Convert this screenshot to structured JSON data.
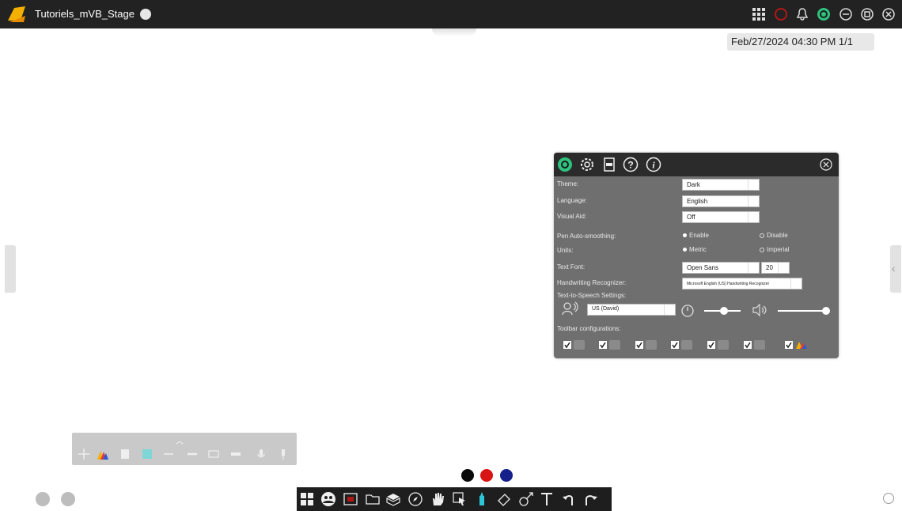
{
  "app": {
    "title": "Tutoriels_mVB_Stage"
  },
  "status": {
    "date": "Feb/27/2024",
    "time": "04:30 PM",
    "page": "1/1"
  },
  "settings": {
    "tabs": [
      "theme-icon",
      "gear-icon",
      "app-icon",
      "help-icon",
      "info-icon"
    ],
    "theme_label": "Theme:",
    "theme_value": "Dark",
    "language_label": "Language:",
    "language_value": "English",
    "visual_aid_label": "Visual Aid:",
    "visual_aid_value": "Off",
    "pen_label": "Pen Auto-smoothing:",
    "pen_enable": "Enable",
    "pen_disable": "Disable",
    "units_label": "Units:",
    "units_metric": "Metric",
    "units_imperial": "Imperial",
    "text_font_label": "Text Font:",
    "font_value": "Open Sans",
    "font_size": "20",
    "handwriting_label": "Handwriting Recognizer:",
    "handwriting_value": "Microsoft English (US) Handwriting Recognizer",
    "tts_label": "Text-to-Speech Settings:",
    "tts_voice": "US  (David)",
    "toolbar_config_label": "Toolbar configurations:"
  },
  "colors": {
    "black": "#0a0a0a",
    "red": "#d81414",
    "blue": "#16208a",
    "accent_green": "#2ec27e",
    "red_badge": "#c81e1e"
  },
  "pen_colors": [
    "#0a0a0a",
    "#d81414",
    "#16208a"
  ]
}
